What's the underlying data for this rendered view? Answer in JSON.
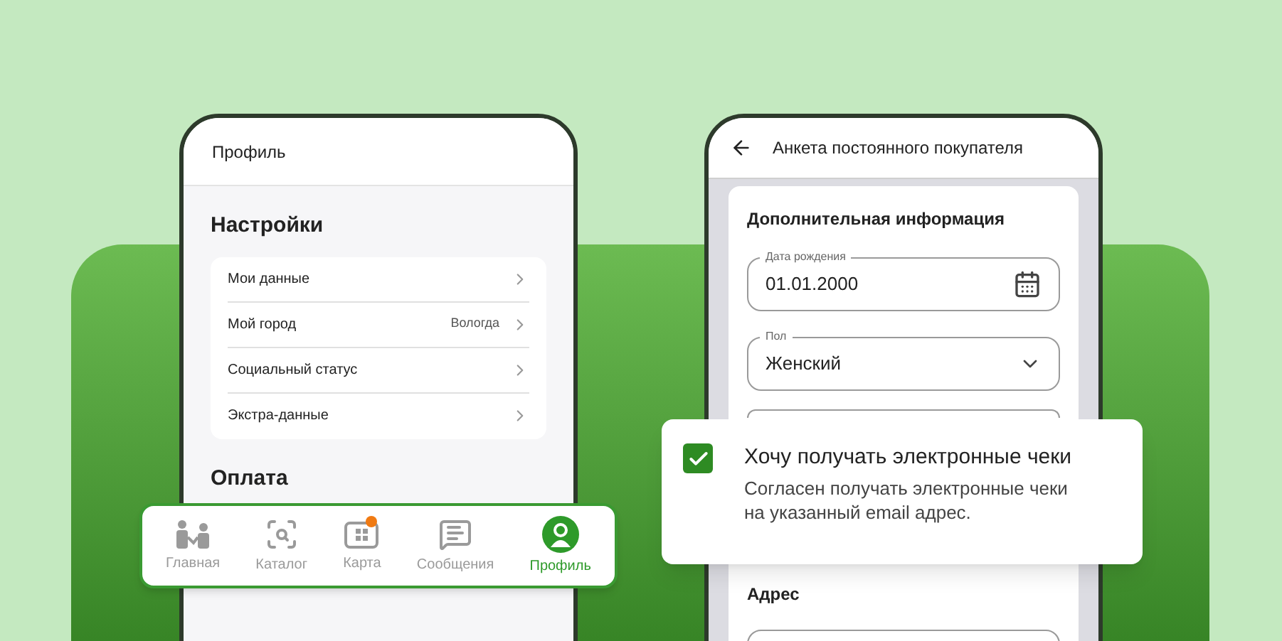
{
  "profile_screen": {
    "title": "Профиль",
    "settings": {
      "heading": "Настройки",
      "items": [
        {
          "label": "Мои данные"
        },
        {
          "label": "Мой город",
          "value": "Вологда"
        },
        {
          "label": "Социальный статус"
        },
        {
          "label": "Экстра-данные"
        }
      ]
    },
    "payment": {
      "heading": "Оплата"
    }
  },
  "bottom_nav": [
    {
      "label": "Главная",
      "kind": "home",
      "selected": false,
      "badge": false
    },
    {
      "label": "Каталог",
      "kind": "catalog",
      "selected": false,
      "badge": false
    },
    {
      "label": "Карта",
      "kind": "card",
      "selected": false,
      "badge": true
    },
    {
      "label": "Сообщения",
      "kind": "messages",
      "selected": false,
      "badge": false
    },
    {
      "label": "Профиль",
      "kind": "profile",
      "selected": true,
      "badge": false
    }
  ],
  "form_screen": {
    "title": "Анкета постоянного покупателя",
    "section": "Дополнительная информация",
    "fields": [
      {
        "kind": "date",
        "label": "Дата рождения",
        "value": "01.01.2000"
      },
      {
        "kind": "select",
        "label": "Пол",
        "value": "Женский"
      },
      {
        "kind": "blank"
      }
    ],
    "address_heading": "Адрес"
  },
  "consent": {
    "title": "Хочу получать электронные чеки",
    "text": "Согласен получать электронные чеки на указанный email адрес.",
    "checked": true
  }
}
